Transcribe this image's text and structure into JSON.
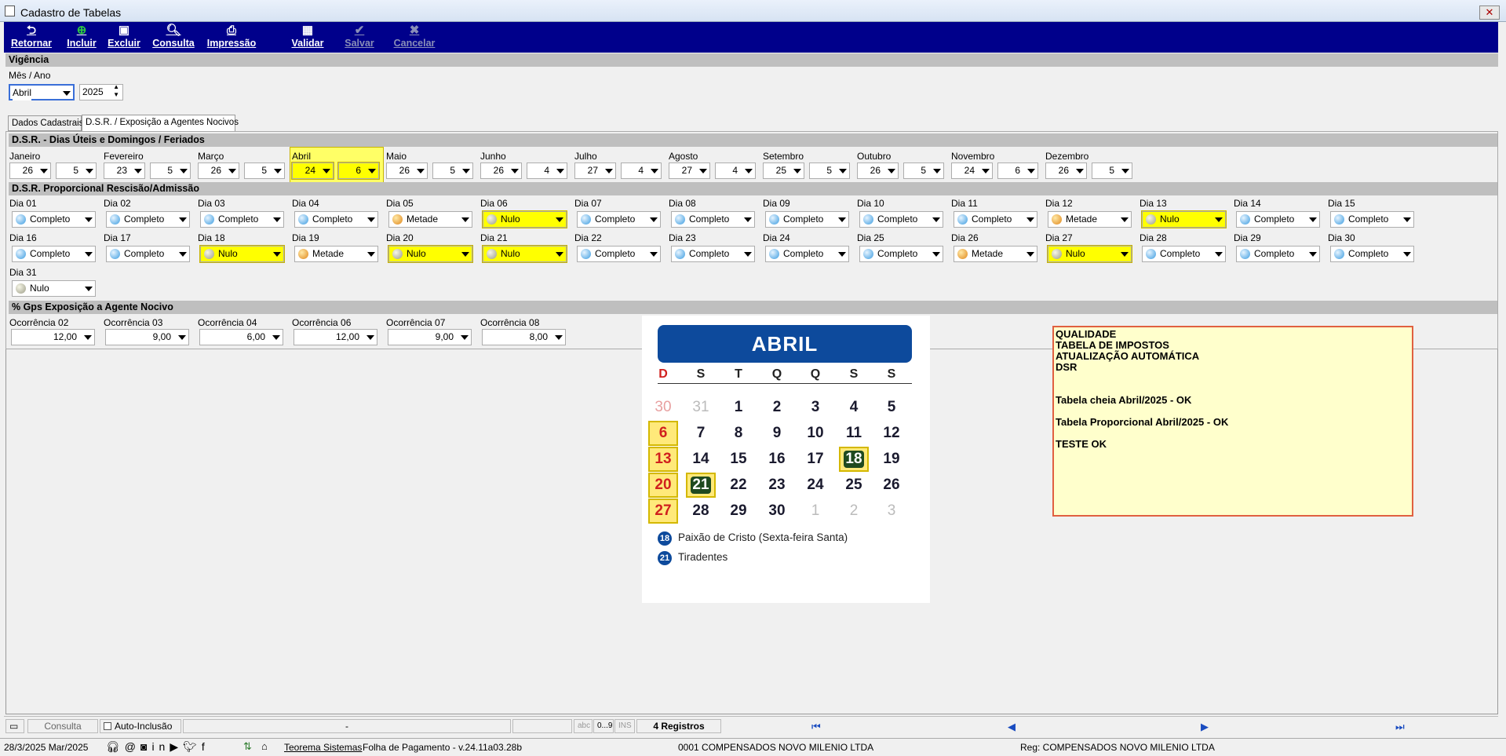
{
  "window": {
    "title": "Cadastro de Tabelas"
  },
  "toolbar": {
    "retornar": "Retornar",
    "incluir": "Incluir",
    "excluir": "Excluir",
    "consulta": "Consulta",
    "impressao": "Impressão",
    "validar": "Validar",
    "salvar": "Salvar",
    "cancelar": "Cancelar"
  },
  "vigencia": {
    "title": "Vigência",
    "label": "Mês / Ano",
    "month": "Abril",
    "year": "2025"
  },
  "tabs": [
    "Dados Cadastrais",
    "D.S.R. / Exposição a Agentes Nocivos"
  ],
  "dsr": {
    "title": "D.S.R. - Dias Úteis e Domingos / Feriados",
    "months": [
      {
        "name": "Janeiro",
        "uteis": "26",
        "domingos": "5"
      },
      {
        "name": "Fevereiro",
        "uteis": "23",
        "domingos": "5"
      },
      {
        "name": "Março",
        "uteis": "26",
        "domingos": "5"
      },
      {
        "name": "Abril",
        "uteis": "24",
        "domingos": "6",
        "highlight": true
      },
      {
        "name": "Maio",
        "uteis": "26",
        "domingos": "5"
      },
      {
        "name": "Junho",
        "uteis": "26",
        "domingos": "4"
      },
      {
        "name": "Julho",
        "uteis": "27",
        "domingos": "4"
      },
      {
        "name": "Agosto",
        "uteis": "27",
        "domingos": "4"
      },
      {
        "name": "Setembro",
        "uteis": "25",
        "domingos": "5"
      },
      {
        "name": "Outubro",
        "uteis": "26",
        "domingos": "5"
      },
      {
        "name": "Novembro",
        "uteis": "24",
        "domingos": "6"
      },
      {
        "name": "Dezembro",
        "uteis": "26",
        "domingos": "5"
      }
    ]
  },
  "prop": {
    "title": "D.S.R. Proporcional Rescisão/Admissão",
    "days": [
      {
        "label": "Dia 01",
        "value": "Completo",
        "kind": "b"
      },
      {
        "label": "Dia 02",
        "value": "Completo",
        "kind": "b"
      },
      {
        "label": "Dia 03",
        "value": "Completo",
        "kind": "b"
      },
      {
        "label": "Dia 04",
        "value": "Completo",
        "kind": "b"
      },
      {
        "label": "Dia 05",
        "value": "Metade",
        "kind": "o"
      },
      {
        "label": "Dia 06",
        "value": "Nulo",
        "kind": "n",
        "hl": true
      },
      {
        "label": "Dia 07",
        "value": "Completo",
        "kind": "b"
      },
      {
        "label": "Dia 08",
        "value": "Completo",
        "kind": "b"
      },
      {
        "label": "Dia 09",
        "value": "Completo",
        "kind": "b"
      },
      {
        "label": "Dia 10",
        "value": "Completo",
        "kind": "b"
      },
      {
        "label": "Dia 11",
        "value": "Completo",
        "kind": "b"
      },
      {
        "label": "Dia 12",
        "value": "Metade",
        "kind": "o"
      },
      {
        "label": "Dia 13",
        "value": "Nulo",
        "kind": "n",
        "hl": true
      },
      {
        "label": "Dia 14",
        "value": "Completo",
        "kind": "b"
      },
      {
        "label": "Dia 15",
        "value": "Completo",
        "kind": "b"
      },
      {
        "label": "Dia 16",
        "value": "Completo",
        "kind": "b"
      },
      {
        "label": "Dia 17",
        "value": "Completo",
        "kind": "b"
      },
      {
        "label": "Dia 18",
        "value": "Nulo",
        "kind": "n",
        "hl": true
      },
      {
        "label": "Dia 19",
        "value": "Metade",
        "kind": "o"
      },
      {
        "label": "Dia 20",
        "value": "Nulo",
        "kind": "n",
        "hl": true
      },
      {
        "label": "Dia 21",
        "value": "Nulo",
        "kind": "n",
        "hl": true
      },
      {
        "label": "Dia 22",
        "value": "Completo",
        "kind": "b"
      },
      {
        "label": "Dia 23",
        "value": "Completo",
        "kind": "b"
      },
      {
        "label": "Dia 24",
        "value": "Completo",
        "kind": "b"
      },
      {
        "label": "Dia 25",
        "value": "Completo",
        "kind": "b"
      },
      {
        "label": "Dia 26",
        "value": "Metade",
        "kind": "o"
      },
      {
        "label": "Dia 27",
        "value": "Nulo",
        "kind": "n",
        "hl": true
      },
      {
        "label": "Dia 28",
        "value": "Completo",
        "kind": "b"
      },
      {
        "label": "Dia 29",
        "value": "Completo",
        "kind": "b"
      },
      {
        "label": "Dia 30",
        "value": "Completo",
        "kind": "b"
      },
      {
        "label": "Dia 31",
        "value": "Nulo",
        "kind": "n"
      }
    ]
  },
  "gps": {
    "title": "% Gps Exposição a Agente Nocivo",
    "items": [
      {
        "label": "Ocorrência 02",
        "value": "12,00"
      },
      {
        "label": "Ocorrência 03",
        "value": "9,00"
      },
      {
        "label": "Ocorrência 04",
        "value": "6,00"
      },
      {
        "label": "Ocorrência 06",
        "value": "12,00"
      },
      {
        "label": "Ocorrência 07",
        "value": "9,00"
      },
      {
        "label": "Ocorrência 08",
        "value": "8,00"
      }
    ]
  },
  "calendar": {
    "title": "ABRIL",
    "weekdays": [
      "D",
      "S",
      "T",
      "Q",
      "Q",
      "S",
      "S"
    ],
    "rows": [
      [
        "30",
        "31",
        "1",
        "2",
        "3",
        "4",
        "5"
      ],
      [
        "6",
        "7",
        "8",
        "9",
        "10",
        "11",
        "12"
      ],
      [
        "13",
        "14",
        "15",
        "16",
        "17",
        "18",
        "19"
      ],
      [
        "20",
        "21",
        "22",
        "23",
        "24",
        "25",
        "26"
      ],
      [
        "27",
        "28",
        "29",
        "30",
        "1",
        "2",
        "3"
      ]
    ],
    "legend": [
      {
        "num": "18",
        "text": "Paixão de Cristo (Sexta-feira Santa)"
      },
      {
        "num": "21",
        "text": "Tiradentes"
      }
    ]
  },
  "note": {
    "lines": [
      "QUALIDADE",
      "TABELA DE IMPOSTOS",
      "ATUALIZAÇÃO AUTOMÁTICA",
      "DSR",
      "",
      "",
      "Tabela cheia Abril/2025 - OK",
      "",
      "Tabela Proporcional Abril/2025 - OK",
      "",
      "TESTE OK"
    ]
  },
  "statusbar": {
    "mode": "Consulta",
    "auto": "Auto-Inclusão",
    "dash": "-",
    "abc": "abc",
    "num": "0...9",
    "ins": "INS",
    "records": "4 Registros"
  },
  "footer": {
    "date": "28/3/2025 Mar/2025",
    "company_link": "Teorema Sistemas",
    "app": "Folha de Pagamento - v.24.11a03.28b",
    "empresa": "0001 COMPENSADOS NOVO MILENIO LTDA",
    "reg": "Reg: COMPENSADOS NOVO MILENIO LTDA"
  }
}
